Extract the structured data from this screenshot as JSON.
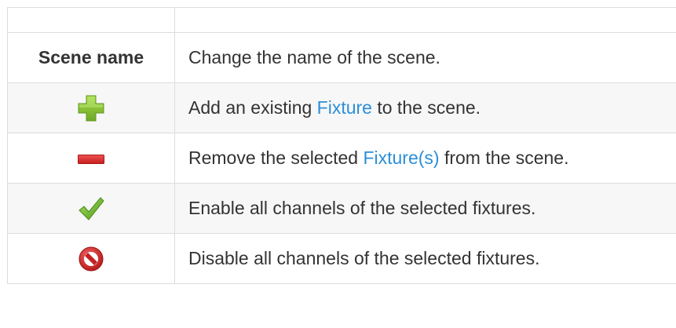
{
  "rows": [
    {
      "left_text": "Scene name",
      "description": "Change the name of the scene."
    },
    {
      "icon": "add-plus-icon",
      "desc_before": "Add an existing ",
      "link": "Fixture",
      "desc_after": " to the scene."
    },
    {
      "icon": "remove-minus-icon",
      "desc_before": "Remove the selected ",
      "link": "Fixture(s)",
      "desc_after": " from the scene."
    },
    {
      "icon": "checkmark-icon",
      "description": "Enable all channels of the selected fixtures."
    },
    {
      "icon": "no-entry-icon",
      "description": "Disable all channels of the selected fixtures."
    }
  ],
  "colors": {
    "link": "#2c8ed8",
    "row_shade": "#f7f7f7",
    "border": "#dddddd",
    "text": "#333333"
  }
}
